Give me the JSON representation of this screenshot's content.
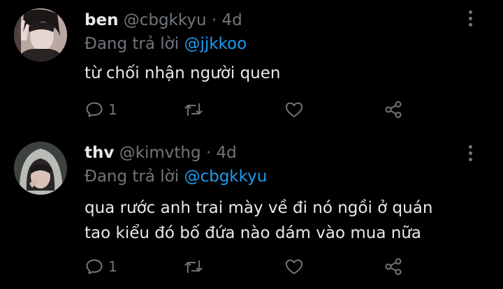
{
  "tweets": [
    {
      "name": "ben",
      "handle": "@cbgkkyu",
      "separator": "·",
      "time": "4d",
      "reply_prefix": "Đang trả lời",
      "reply_to": "@jjkkoo",
      "lines": [
        "từ chối nhận người quen"
      ],
      "reply_count": "1"
    },
    {
      "name": "thv",
      "handle": "@kimvthg",
      "separator": "·",
      "time": "4d",
      "reply_prefix": "Đang trả lời",
      "reply_to": "@cbgkkyu",
      "lines": [
        "qua rước anh trai mày về đi nó ngồi ở quán",
        "tao kiểu đó bố đứa nào dám vào mua nữa"
      ],
      "reply_count": "1"
    }
  ],
  "icons": {
    "reply": "comment-icon",
    "retweet": "retweet-icon",
    "like": "heart-icon",
    "share": "share-icon",
    "more": "more-vertical-icon"
  },
  "colors": {
    "background": "#000000",
    "text": "#e7e9ea",
    "muted": "#71767b",
    "link": "#1d9bf0"
  }
}
